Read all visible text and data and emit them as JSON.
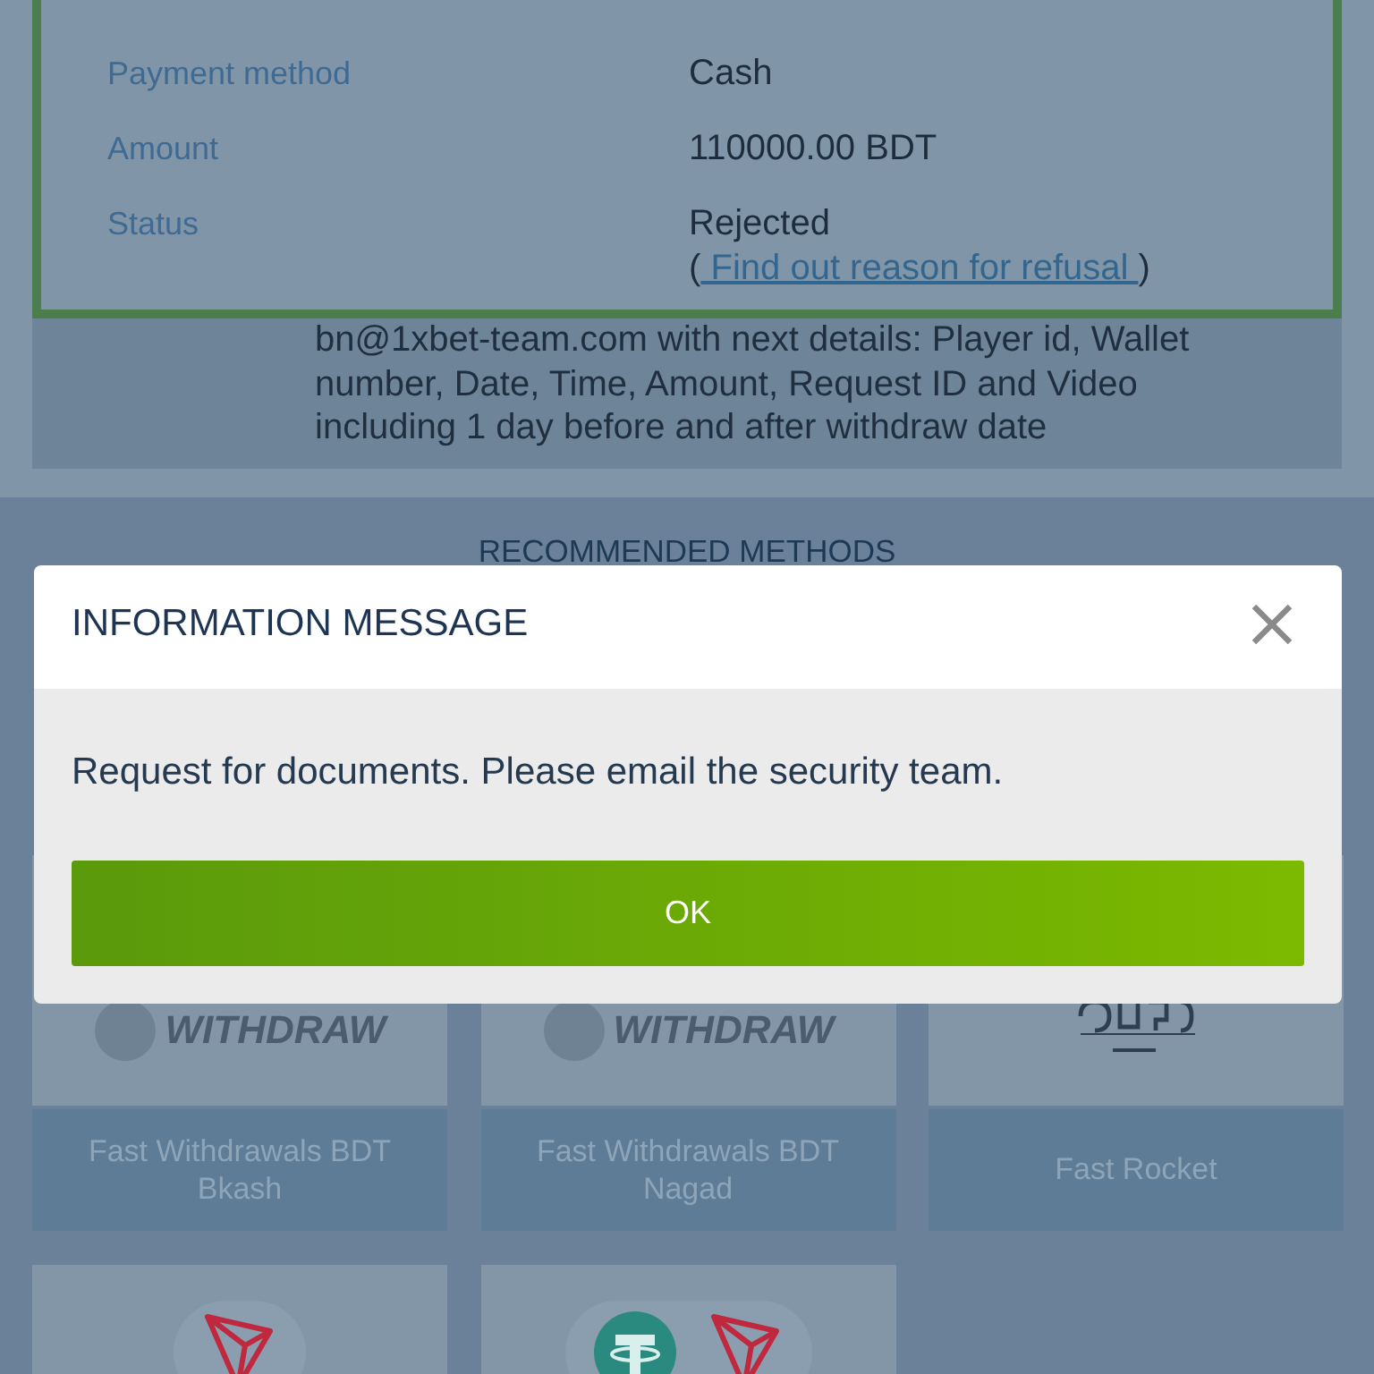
{
  "details": [
    {
      "label": "Payment method",
      "value": "Cash"
    },
    {
      "label": "Amount",
      "value": "110000.00 BDT"
    },
    {
      "label": "Status",
      "value": "Rejected (",
      "link": " Find out reason for refusal ",
      "value_end": ")"
    }
  ],
  "note": "bn@1xbet-team.com with next details: Player id, Wallet number, Date, Time, Amount, Request ID and Video including 1 day before and after withdraw date",
  "section_title": "RECOMMENDED METHODS",
  "methods": [
    {
      "kind": "withdraw",
      "logo_text": "WITHDRAW",
      "name": "Fast Withdrawals BDT Bkash"
    },
    {
      "kind": "withdraw",
      "logo_text": "WITHDRAW",
      "name": "Fast Withdrawals BDT Nagad"
    },
    {
      "kind": "rocket",
      "name": "Fast Rocket"
    },
    {
      "kind": "tron"
    },
    {
      "kind": "tether-tron"
    }
  ],
  "dialog": {
    "title": "INFORMATION MESSAGE",
    "message": "Request for documents. Please email the security team.",
    "button": "OK"
  }
}
